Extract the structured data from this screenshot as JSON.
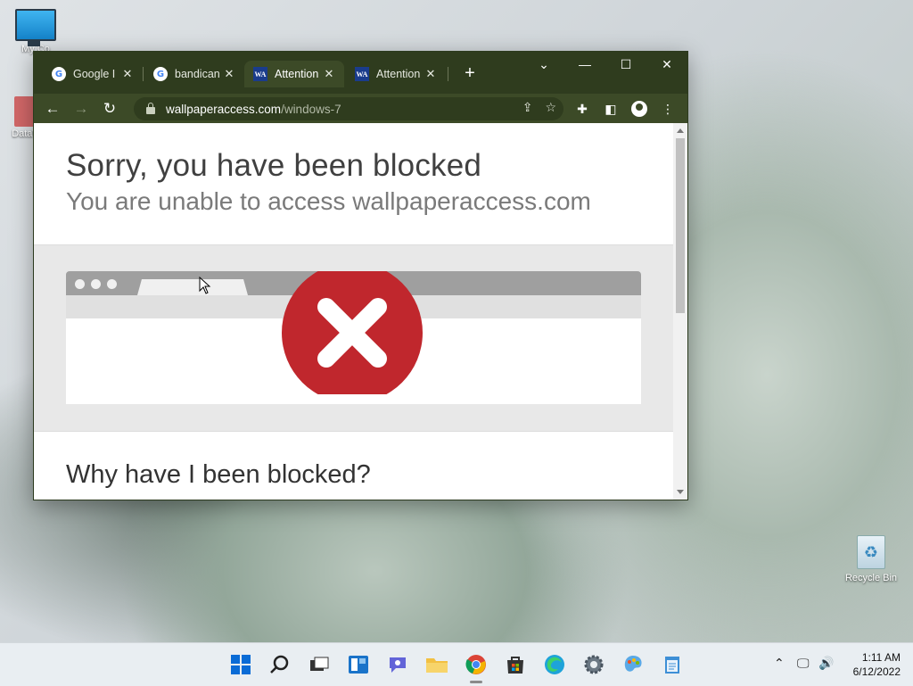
{
  "desktop": {
    "icons": [
      {
        "label": "My Co"
      },
      {
        "label": "DataW"
      },
      {
        "label": "Recycle Bin"
      }
    ]
  },
  "browser": {
    "tabs": [
      {
        "title": "Google I",
        "favicon": "google-icon",
        "active": false
      },
      {
        "title": "bandican",
        "favicon": "google-icon",
        "active": false
      },
      {
        "title": "Attention",
        "favicon": "wallpaperaccess-icon",
        "active": true
      },
      {
        "title": "Attention",
        "favicon": "wallpaperaccess-icon",
        "active": false
      }
    ],
    "favicon_wa_text": "WA",
    "favicon_g_text": "G",
    "new_tab_label": "+",
    "url_host": "wallpaperaccess.com",
    "url_path": "/windows-7",
    "theme_color": "#3c4a27"
  },
  "page": {
    "headline": "Sorry, you have been blocked",
    "subline": "You are unable to access wallpaperaccess.com",
    "section_heading": "Why have I been blocked?",
    "block_icon_color": "#c0272d"
  },
  "taskbar": {
    "apps": [
      "start-icon",
      "search-icon",
      "task-view-icon",
      "widgets-icon",
      "chat-icon",
      "file-explorer-icon",
      "chrome-icon",
      "store-icon",
      "edge-icon",
      "settings-icon",
      "paint-icon",
      "notepad-icon"
    ],
    "time": "1:11 AM",
    "date": "6/12/2022"
  }
}
